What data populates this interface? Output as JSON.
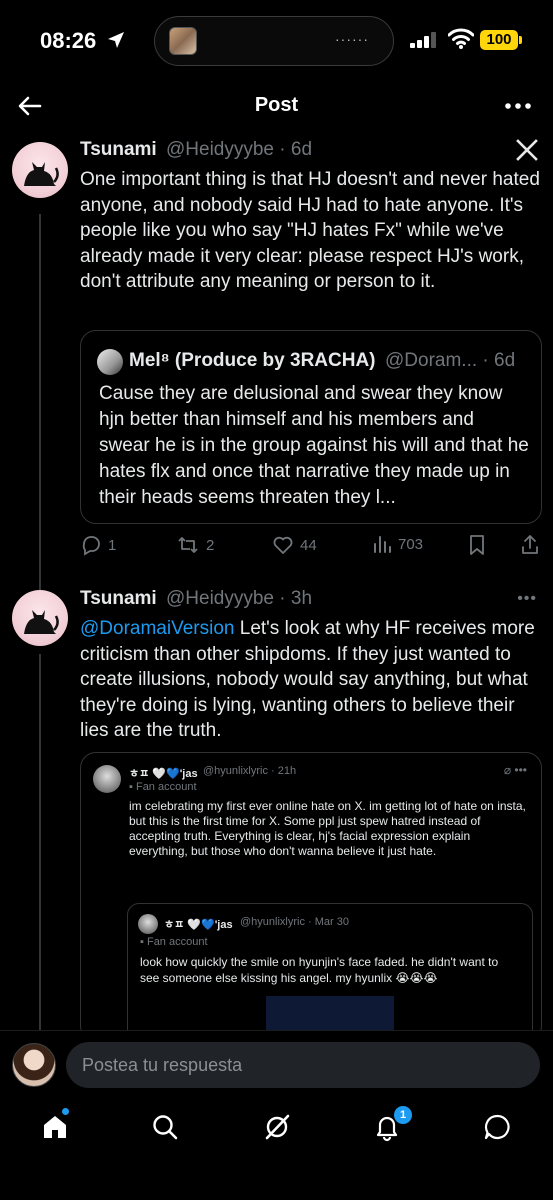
{
  "status_bar": {
    "time": "08:26",
    "battery": "100"
  },
  "header": {
    "title": "Post"
  },
  "tweet1": {
    "name": "Tsunami",
    "handle_time": "@Heidyyybe · 6d",
    "text": "One important thing is that HJ doesn't and never hated anyone, and nobody said HJ had to hate anyone. It's people like you who say \"HJ hates Fx\" while we've already made it very clear: please respect HJ's work, don't attribute any meaning or person to it.",
    "quote": {
      "name": "Mel⁸ (Produce by 3RACHA)",
      "handle_time": "@Doram... · 6d",
      "text": "Cause they are delusional and swear they know hjn better than himself and his members and swear he is in the group against his will and that he hates flx and once that narrative they made up in their heads seems threaten they l..."
    },
    "actions": {
      "replies": "1",
      "reposts": "2",
      "likes": "44",
      "views": "703"
    }
  },
  "tweet2": {
    "name": "Tsunami",
    "handle_time": "@Heidyyybe · 3h",
    "mention": "@DoramaiVersion",
    "text": " Let's look at why HF receives more criticism than other shipdoms. If they just wanted to create illusions, nobody would say anything, but what they're doing is lying, wanting others to believe their lies are the truth.",
    "embed": {
      "name": "ㅎㅍ 🤍💙'jas",
      "handle_time": "@hyunlixlyric · 21h",
      "fan_label": "Fan account",
      "text": "im celebrating my first ever online hate on X. im getting lot of hate on insta, but this is the first time for X. Some ppl just spew hatred instead of accepting truth. Everything is clear, hj's facial expression explain everything, but those who don't wanna believe it just hate.",
      "inner": {
        "name": "ㅎㅍ 🤍💙'jas",
        "handle_time": "@hyunlixlyric · Mar 30",
        "fan_label": "Fan account",
        "text": "look how quickly the smile on hyunjin's face faded. he didn't want to see someone else kissing his angel. my hyunlix 😭😭😭"
      }
    }
  },
  "reply": {
    "placeholder": "Postea tu respuesta"
  },
  "tabbar": {
    "notif_count": "1"
  },
  "icons": [
    "back-arrow-icon",
    "more-icon",
    "x-logo-icon",
    "reply-icon",
    "repost-icon",
    "like-icon",
    "views-icon",
    "bookmark-icon",
    "share-icon",
    "home-icon",
    "search-icon",
    "grok-icon",
    "bell-icon",
    "messages-icon"
  ],
  "colors": {
    "accent": "#1d9bf0",
    "muted": "#71767b",
    "battery": "#ffd60a"
  }
}
